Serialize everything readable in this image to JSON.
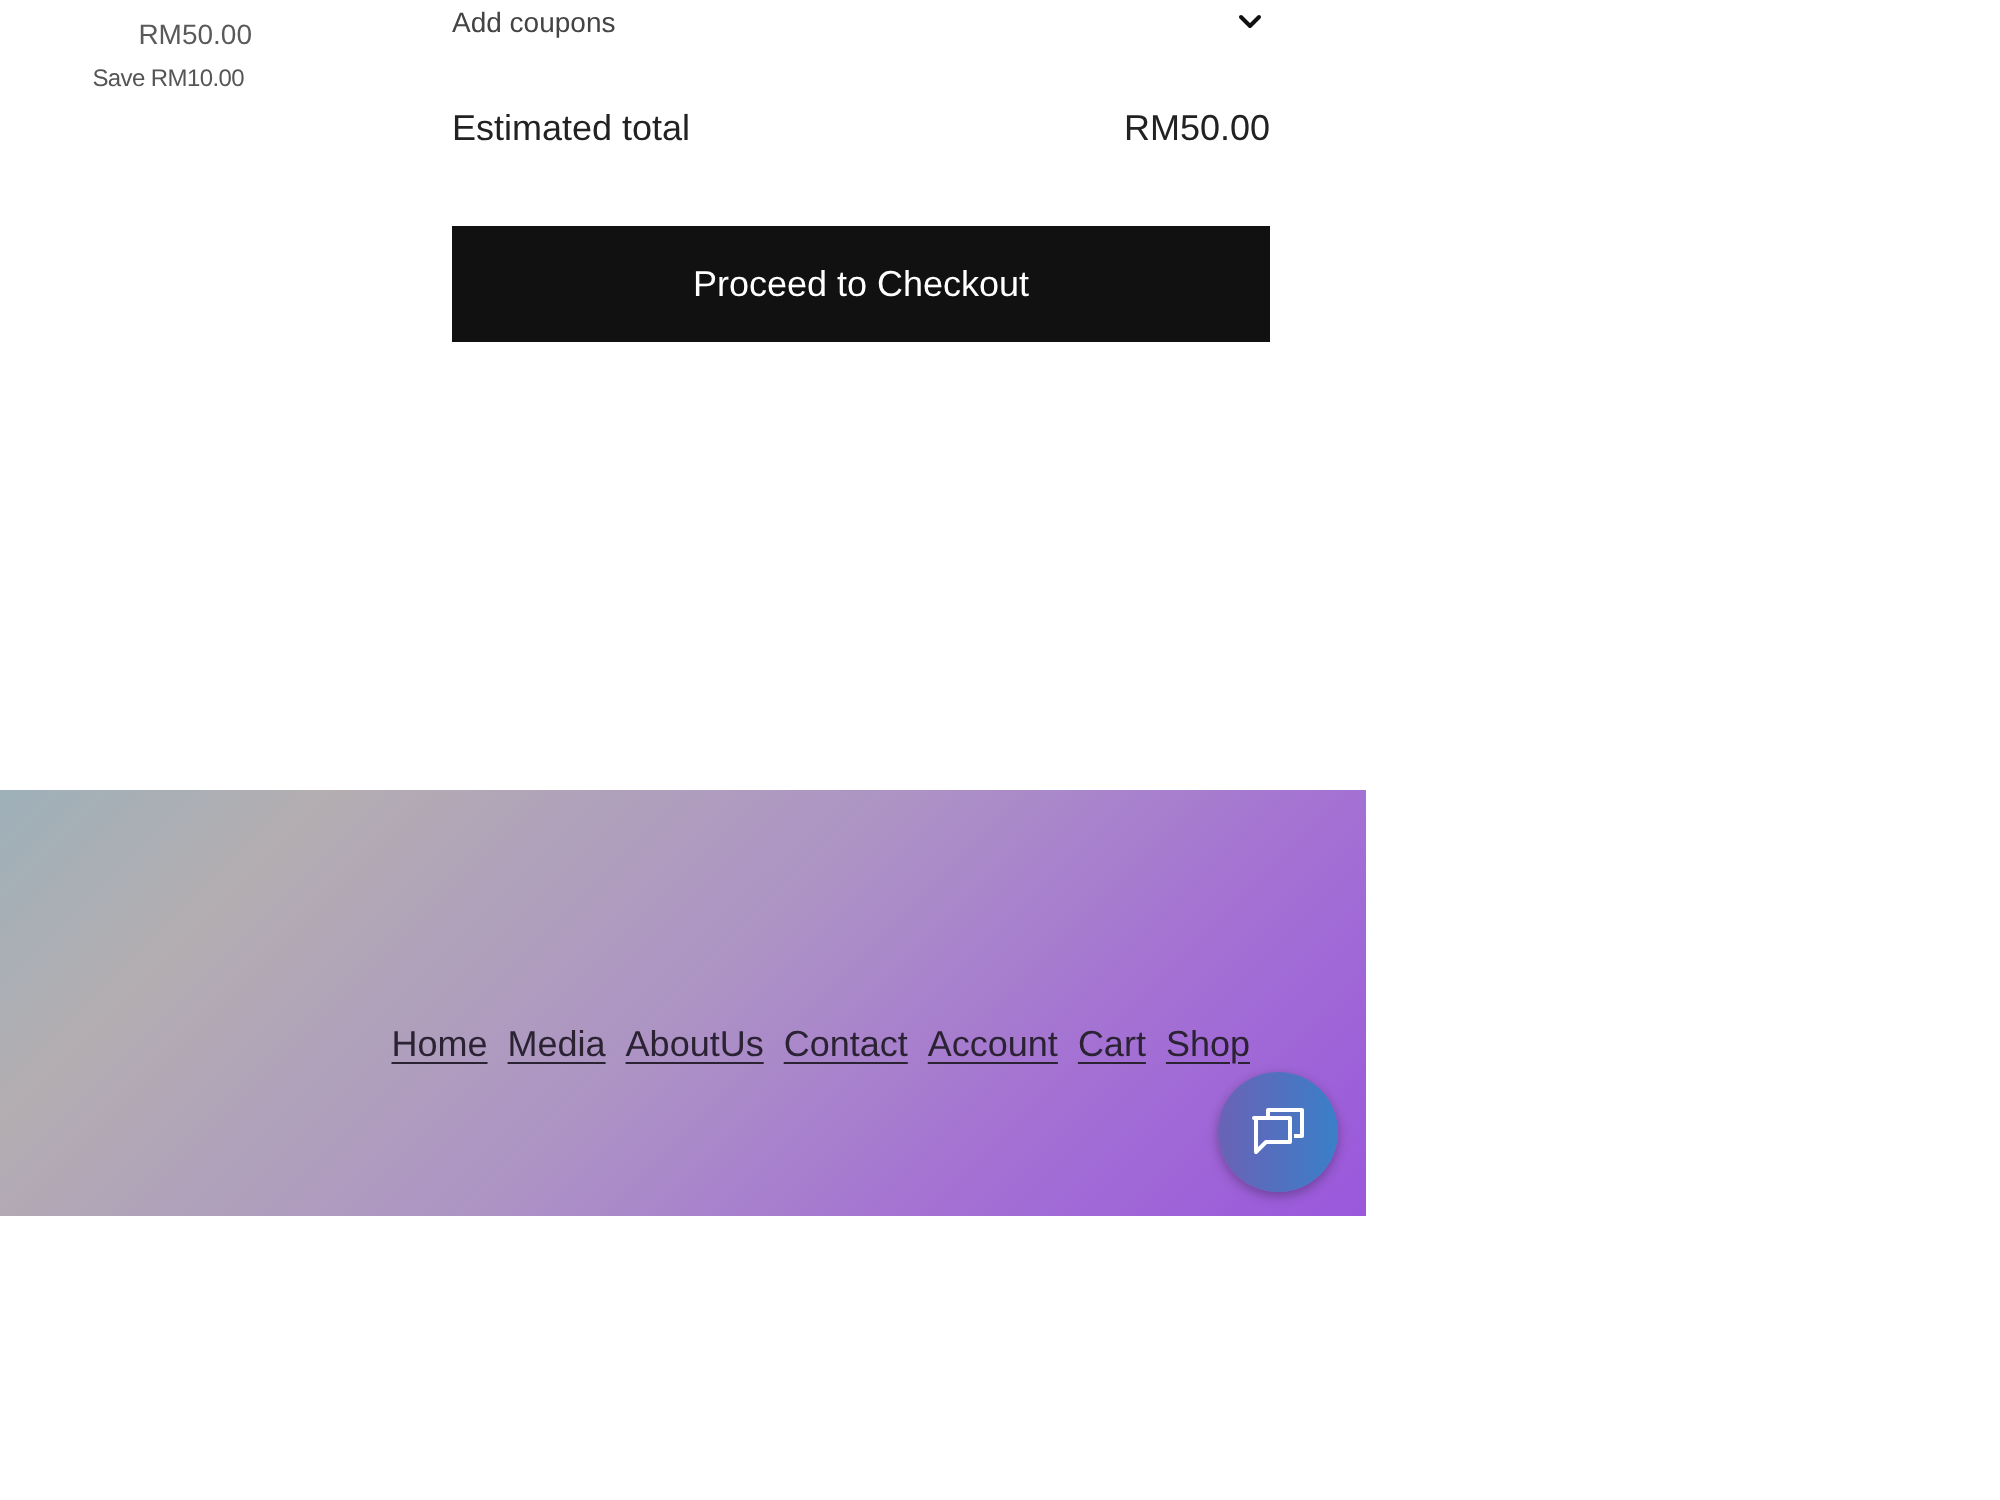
{
  "item": {
    "price": "RM50.00",
    "savings": "Save RM10.00"
  },
  "summary": {
    "coupons": {
      "label": "Add coupons",
      "expanded": false
    },
    "estimated_total": {
      "label": "Estimated total",
      "value": "RM50.00"
    },
    "checkout_button": "Proceed to Checkout"
  },
  "footer": {
    "links": [
      "Home",
      "Media",
      "AboutUs",
      "Contact",
      "Account",
      "Cart",
      "Shop"
    ]
  }
}
